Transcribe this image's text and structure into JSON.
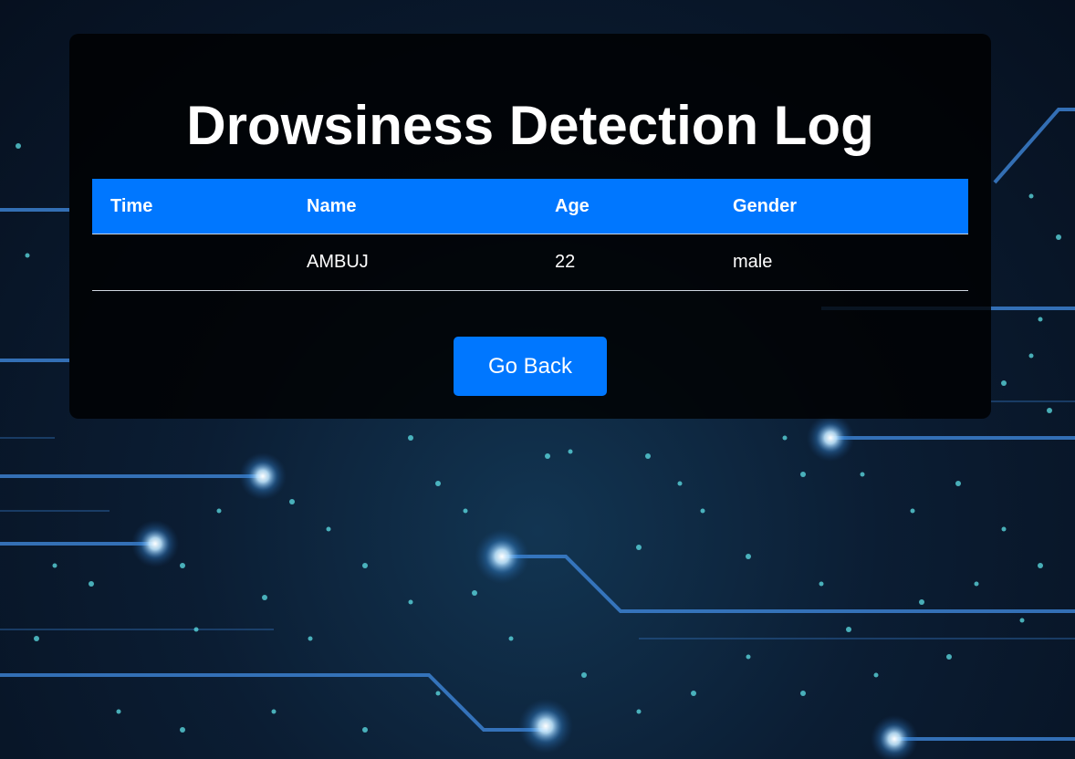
{
  "page": {
    "title": "Drowsiness Detection Log"
  },
  "table": {
    "columns": [
      "Time",
      "Name",
      "Age",
      "Gender"
    ],
    "rows": [
      [
        "",
        "AMBUJ",
        "22",
        "male"
      ]
    ]
  },
  "actions": {
    "go_back_label": "Go Back"
  },
  "colors": {
    "accent": "#0077ff",
    "panel_background": "#000000",
    "text": "#ffffff"
  }
}
